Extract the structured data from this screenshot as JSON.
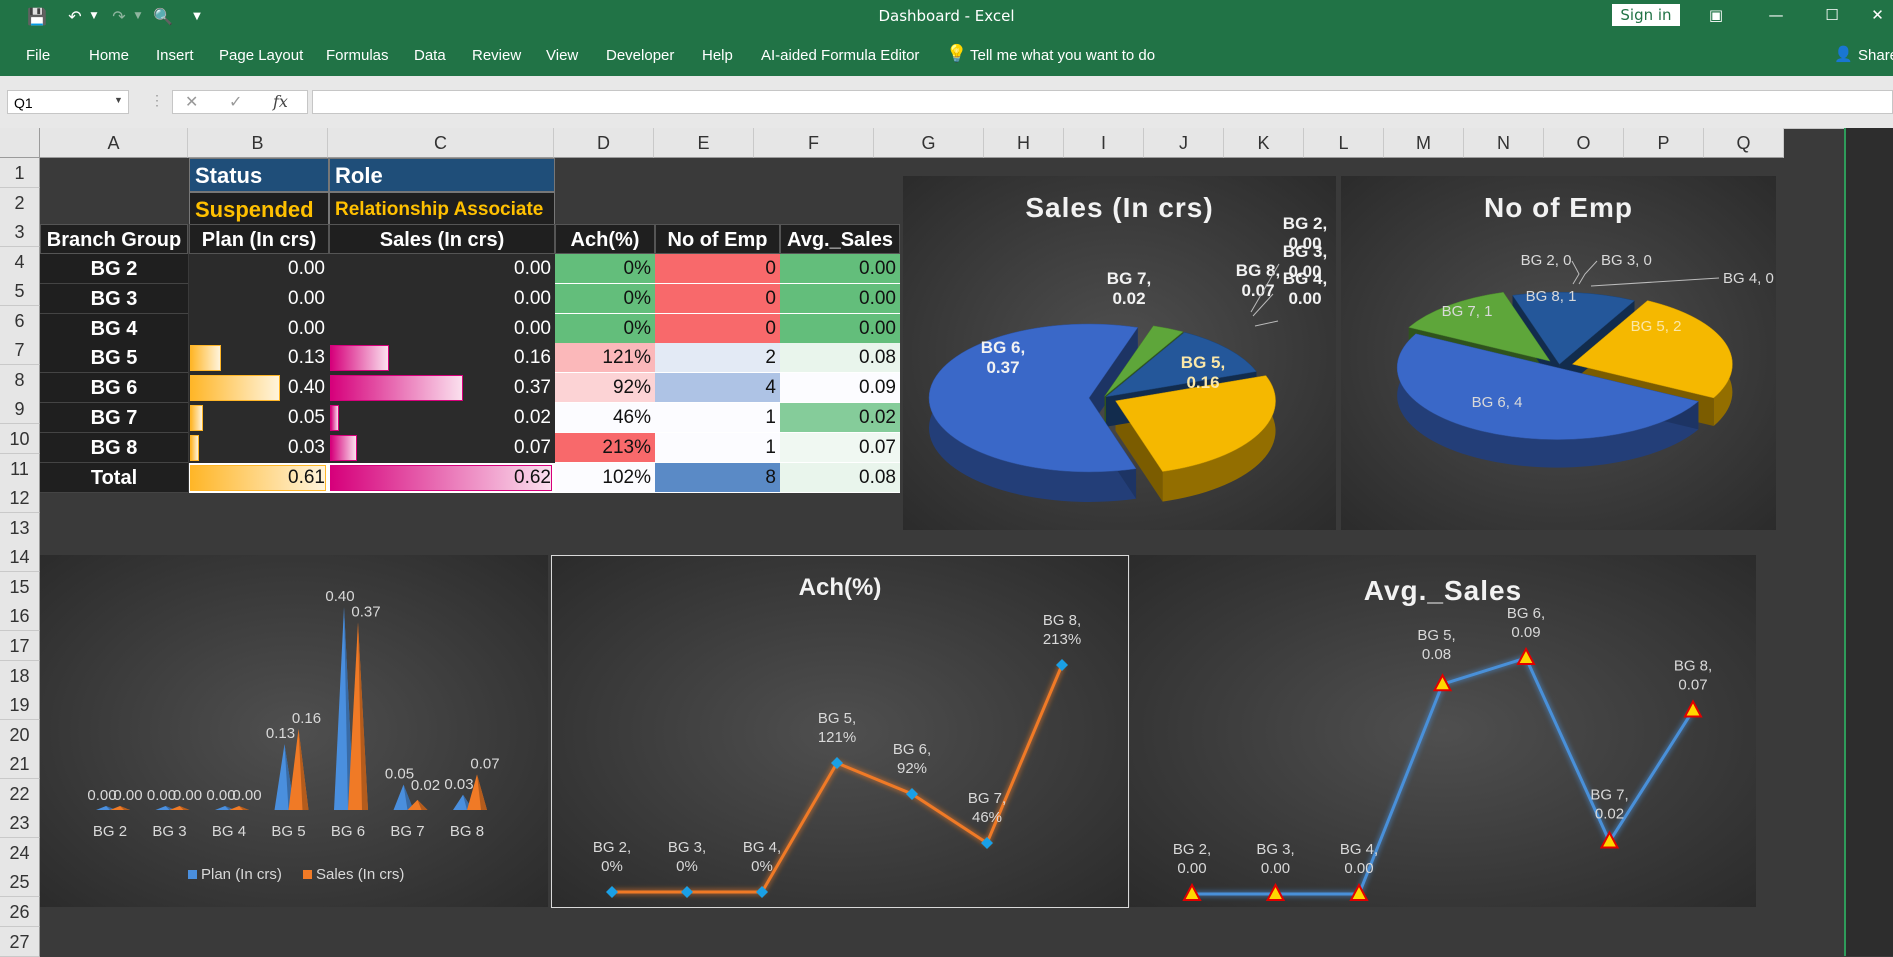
{
  "window": {
    "title": "Dashboard  -  Excel",
    "sign_in": "Sign in"
  },
  "ribbon": {
    "tabs": [
      "File",
      "Home",
      "Insert",
      "Page Layout",
      "Formulas",
      "Data",
      "Review",
      "View",
      "Developer",
      "Help",
      "AI-aided Formula Editor"
    ],
    "tell_me": "Tell me what you want to do",
    "share": "Share"
  },
  "formula_bar": {
    "name_box": "Q1",
    "fx": "fx",
    "formula": ""
  },
  "columns": [
    "A",
    "B",
    "C",
    "D",
    "E",
    "F",
    "G",
    "H",
    "I",
    "J",
    "K",
    "L",
    "M",
    "N",
    "O",
    "P",
    "Q"
  ],
  "rows": [
    "1",
    "2",
    "3",
    "4",
    "5",
    "6",
    "7",
    "8",
    "9",
    "10",
    "11",
    "12",
    "13",
    "14",
    "15",
    "16",
    "17",
    "18",
    "19",
    "20",
    "21",
    "22",
    "23",
    "24",
    "25",
    "26",
    "27"
  ],
  "filter": {
    "status_label": "Status",
    "status_value": "Suspended",
    "role_label": "Role",
    "role_value": "Relationship Associate"
  },
  "table": {
    "headers": [
      "Branch Group",
      "Plan (In crs)",
      "Sales (In crs)",
      "Ach(%)",
      "No of Emp",
      "Avg._Sales"
    ],
    "rows": [
      {
        "group": "BG 2",
        "plan": "0.00",
        "sales": "0.00",
        "ach": "0%",
        "emp": "0",
        "avg": "0.00"
      },
      {
        "group": "BG 3",
        "plan": "0.00",
        "sales": "0.00",
        "ach": "0%",
        "emp": "0",
        "avg": "0.00"
      },
      {
        "group": "BG 4",
        "plan": "0.00",
        "sales": "0.00",
        "ach": "0%",
        "emp": "0",
        "avg": "0.00"
      },
      {
        "group": "BG 5",
        "plan": "0.13",
        "sales": "0.16",
        "ach": "121%",
        "emp": "2",
        "avg": "0.08"
      },
      {
        "group": "BG 6",
        "plan": "0.40",
        "sales": "0.37",
        "ach": "92%",
        "emp": "4",
        "avg": "0.09"
      },
      {
        "group": "BG 7",
        "plan": "0.05",
        "sales": "0.02",
        "ach": "46%",
        "emp": "1",
        "avg": "0.02"
      },
      {
        "group": "BG 8",
        "plan": "0.03",
        "sales": "0.07",
        "ach": "213%",
        "emp": "1",
        "avg": "0.07"
      }
    ],
    "total": {
      "group": "Total",
      "plan": "0.61",
      "sales": "0.62",
      "ach": "102%",
      "emp": "8",
      "avg": "0.08"
    },
    "colors": {
      "ach": [
        "#63be7b",
        "#63be7b",
        "#63be7b",
        "#fbb8ba",
        "#fcd3d5",
        "#fcfcff",
        "#f8696b",
        "#fcfcff"
      ],
      "emp": [
        "#f8696b",
        "#f8696b",
        "#f8696b",
        "#e3eaf5",
        "#aec3e5",
        "#fcfcff",
        "#fcfcff",
        "#5a8ac6"
      ],
      "avg": [
        "#63be7b",
        "#63be7b",
        "#63be7b",
        "#e9f5ec",
        "#fcfcff",
        "#85cc9a",
        "#f0f8f2",
        "#e9f5ec"
      ],
      "plan_bar": "#ffb628",
      "sales_bar": "#d6007b"
    }
  },
  "chart_data": [
    {
      "type": "pie",
      "title": "Sales (In crs)",
      "categories": [
        "BG 2",
        "BG 3",
        "BG 4",
        "BG 5",
        "BG 6",
        "BG 7",
        "BG 8"
      ],
      "values": [
        0.0,
        0.0,
        0.0,
        0.16,
        0.37,
        0.02,
        0.07
      ],
      "labels": [
        [
          "BG 2,",
          "0.00"
        ],
        [
          "BG 3,",
          "0.00"
        ],
        [
          "BG 4,",
          "0.00"
        ],
        [
          "BG 5,",
          "0.16"
        ],
        [
          "BG 6,",
          "0.37"
        ],
        [
          "BG 7,",
          "0.02"
        ],
        [
          "BG 8,",
          "0.07"
        ]
      ],
      "colors": [
        "#7a7a7a",
        "#7a7a7a",
        "#7a7a7a",
        "#f5b800",
        "#3a68c8",
        "#5ea63a",
        "#24579a"
      ]
    },
    {
      "type": "pie",
      "title": "No of Emp",
      "categories": [
        "BG 2",
        "BG 3",
        "BG 4",
        "BG 5",
        "BG 6",
        "BG 7",
        "BG 8"
      ],
      "values": [
        0,
        0,
        0,
        2,
        4,
        1,
        1
      ],
      "labels": [
        "BG 2, 0",
        "BG 3, 0",
        "BG 4, 0",
        "BG 5, 2",
        "BG 6, 4",
        "BG 7, 1",
        "BG 8, 1"
      ],
      "colors": [
        "#7a7a7a",
        "#7a7a7a",
        "#7a7a7a",
        "#f5b800",
        "#3a68c8",
        "#5ea63a",
        "#24579a"
      ]
    },
    {
      "type": "bar",
      "title": "",
      "categories": [
        "BG 2",
        "BG 3",
        "BG 4",
        "BG 5",
        "BG 6",
        "BG 7",
        "BG 8"
      ],
      "series": [
        {
          "name": "Plan (In crs)",
          "values": [
            0.0,
            0.0,
            0.0,
            0.13,
            0.4,
            0.05,
            0.03
          ],
          "color": "#4a8fde"
        },
        {
          "name": "Sales (In crs)",
          "values": [
            0.0,
            0.0,
            0.0,
            0.16,
            0.37,
            0.02,
            0.07
          ],
          "color": "#f07a26"
        }
      ],
      "legend": "bottom"
    },
    {
      "type": "line",
      "title": "Ach(%)",
      "categories": [
        "BG 2",
        "BG 3",
        "BG 4",
        "BG 5",
        "BG 6",
        "BG 7",
        "BG 8"
      ],
      "values": [
        0,
        0,
        0,
        121,
        92,
        46,
        213
      ],
      "labels": [
        [
          "BG 2,",
          "0%"
        ],
        [
          "BG 3,",
          "0%"
        ],
        [
          "BG 4,",
          "0%"
        ],
        [
          "BG 5,",
          "121%"
        ],
        [
          "BG 6,",
          "92%"
        ],
        [
          "BG 7,",
          "46%"
        ],
        [
          "BG 8,",
          "213%"
        ]
      ],
      "color": "#f07a26",
      "marker_color": "#1aa0e6"
    },
    {
      "type": "line",
      "title": "Avg._Sales",
      "categories": [
        "BG 2",
        "BG 3",
        "BG 4",
        "BG 5",
        "BG 6",
        "BG 7",
        "BG 8"
      ],
      "values": [
        0.0,
        0.0,
        0.0,
        0.08,
        0.09,
        0.02,
        0.07
      ],
      "labels": [
        [
          "BG 2,",
          "0.00"
        ],
        [
          "BG 3,",
          "0.00"
        ],
        [
          "BG 4,",
          "0.00"
        ],
        [
          "BG 5,",
          "0.08"
        ],
        [
          "BG 6,",
          "0.09"
        ],
        [
          "BG 7,",
          "0.02"
        ],
        [
          "BG 8,",
          "0.07"
        ]
      ],
      "color": "#4a90d9",
      "marker_color": "#ffd700"
    }
  ]
}
